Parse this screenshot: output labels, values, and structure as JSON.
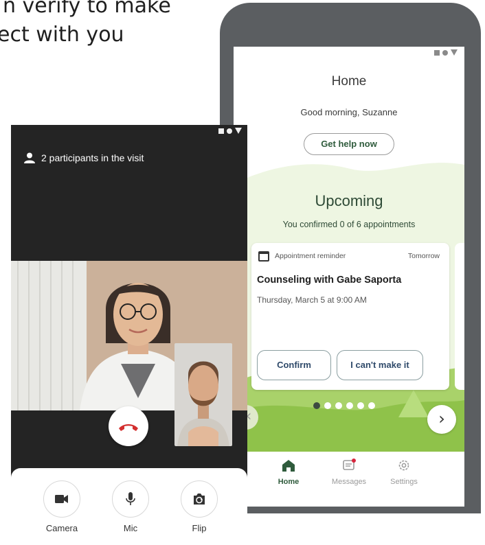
{
  "headline": {
    "line1": "n verify to make",
    "line2": "ect with you"
  },
  "patient_app": {
    "home_title": "Home",
    "greeting": "Good morning, Suzanne",
    "help_button": "Get help now",
    "upcoming_title": "Upcoming",
    "confirmed_text": "You confirmed 0 of 6 appointments",
    "card": {
      "type": "Appointment reminder",
      "when": "Tomorrow",
      "title": "Counseling with Gabe Saporta",
      "datetime": "Thursday, March 5 at 9:00 AM",
      "confirm_label": "Confirm",
      "cant_label": "I can't make it"
    },
    "carousel": {
      "total": 6,
      "active_index": 0
    },
    "nav": [
      {
        "label": "Home",
        "icon": "home-icon",
        "active": true
      },
      {
        "label": "Messages",
        "icon": "messages-icon",
        "active": false
      },
      {
        "label": "Settings",
        "icon": "gear-icon",
        "active": false
      }
    ],
    "colors": {
      "accent_green": "#2f5b3c",
      "wave_green": "#a9d26a",
      "notification": "#d7263d"
    }
  },
  "video_call": {
    "participants_text": "2 participants in the visit",
    "controls": [
      {
        "label": "Camera",
        "icon": "camera-icon"
      },
      {
        "label": "Mic",
        "icon": "mic-icon"
      },
      {
        "label": "Flip",
        "icon": "flip-camera-icon"
      }
    ],
    "end_call_icon": "end-call-icon",
    "colors": {
      "end_call": "#d32f2f",
      "background": "#242424"
    }
  }
}
